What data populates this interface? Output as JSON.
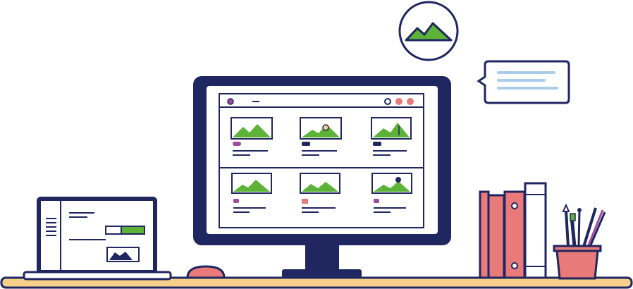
{
  "illustration": {
    "colors": {
      "outline": "#1f2660",
      "green": "#5cb338",
      "pink": "#e87a7a",
      "blue": "#2d5bd6",
      "light_blue": "#a9cdeb",
      "purple": "#a24a9c",
      "desk_top": "#f6d08a",
      "white": "#ffffff"
    },
    "icons": [
      "landscape-bubble-icon",
      "chat-bubble-icon",
      "landscape-thumbnail-icon"
    ],
    "monitor": {
      "gallery_rows": 2,
      "gallery_columns": 3
    }
  }
}
